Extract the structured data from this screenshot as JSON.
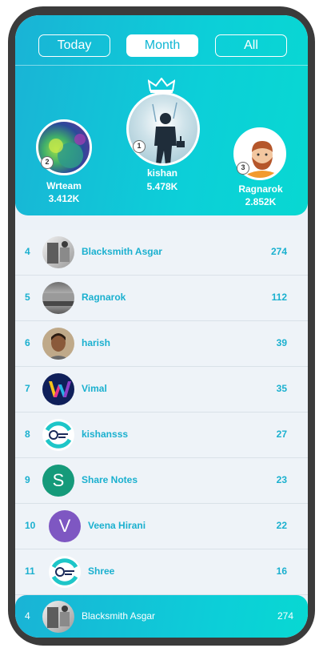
{
  "tabs": [
    {
      "label": "Today",
      "active": false
    },
    {
      "label": "Month",
      "active": true
    },
    {
      "label": "All",
      "active": false
    }
  ],
  "podium": {
    "first": {
      "rank": "1",
      "name": "kishan",
      "score": "5.478K",
      "avatar": "thor-avatar"
    },
    "second": {
      "rank": "2",
      "name": "Wrteam",
      "score": "3.412K",
      "avatar": "bubbles-avatar"
    },
    "third": {
      "rank": "3",
      "name": "Ragnarok",
      "score": "2.852K",
      "avatar": "bearded-man-avatar"
    }
  },
  "leaderboard": [
    {
      "rank": "4",
      "name": "Blacksmith Asgar",
      "score": "274",
      "avatar": "photo"
    },
    {
      "rank": "5",
      "name": "Ragnarok",
      "score": "112",
      "avatar": "photo"
    },
    {
      "rank": "6",
      "name": "harish",
      "score": "39",
      "avatar": "photo"
    },
    {
      "rank": "7",
      "name": "Vimal",
      "score": "35",
      "avatar": "w-logo"
    },
    {
      "rank": "8",
      "name": "kishansss",
      "score": "27",
      "avatar": "quiz-logo"
    },
    {
      "rank": "9",
      "name": "Share Notes",
      "score": "23",
      "avatar": "letter",
      "letter": "S"
    },
    {
      "rank": "10",
      "name": "Veena Hirani",
      "score": "22",
      "avatar": "letter",
      "letter": "V"
    },
    {
      "rank": "11",
      "name": "Shree",
      "score": "16",
      "avatar": "quiz-logo"
    }
  ],
  "current_user": {
    "rank": "4",
    "name": "Blacksmith Asgar",
    "score": "274"
  },
  "colors": {
    "accent": "#1ab0cf",
    "teal": "#08d8d2",
    "share_notes": "#159a7a",
    "veena": "#7e57c2"
  }
}
